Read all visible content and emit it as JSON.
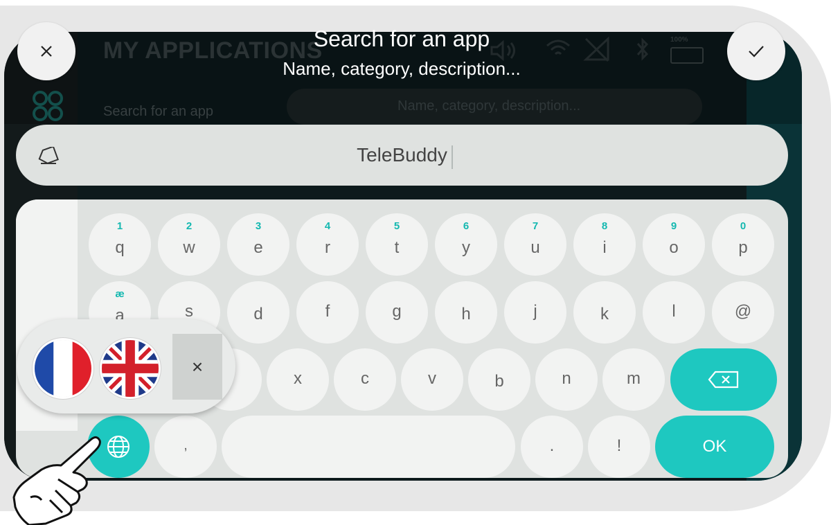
{
  "background": {
    "title": "MY APPLICATIONS",
    "search_label": "Search for an app",
    "search_placeholder": "Name, category, description...",
    "battery": "100%"
  },
  "header": {
    "title": "Search for an app",
    "subtitle": "Name, category, description..."
  },
  "search": {
    "value": "TeleBuddy"
  },
  "keyboard": {
    "row1": [
      {
        "key": "q",
        "alt": "1"
      },
      {
        "key": "w",
        "alt": "2"
      },
      {
        "key": "e",
        "alt": "3"
      },
      {
        "key": "r",
        "alt": "4"
      },
      {
        "key": "t",
        "alt": "5"
      },
      {
        "key": "y",
        "alt": "6"
      },
      {
        "key": "u",
        "alt": "7"
      },
      {
        "key": "i",
        "alt": "8"
      },
      {
        "key": "o",
        "alt": "9"
      },
      {
        "key": "p",
        "alt": "0"
      }
    ],
    "row2": [
      {
        "key": "a",
        "alt": "æ"
      },
      {
        "key": "s"
      },
      {
        "key": "d"
      },
      {
        "key": "f"
      },
      {
        "key": "g"
      },
      {
        "key": "h"
      },
      {
        "key": "j"
      },
      {
        "key": "k"
      },
      {
        "key": "l"
      },
      {
        "key": "@"
      }
    ],
    "row3": [
      "x",
      "c",
      "v",
      "b",
      "n",
      "m"
    ],
    "row3_partial": ".",
    "row4": {
      "comma": ",",
      "period": ".",
      "exclaim": "!"
    },
    "ok_label": "OK"
  },
  "language_popup": {
    "options": [
      "flag-france",
      "flag-united-kingdom"
    ],
    "close_label": "×"
  },
  "icons": {
    "close": "close-icon",
    "confirm": "check-icon",
    "eraser": "eraser-icon",
    "backspace": "backspace-icon",
    "globe": "globe-icon",
    "hand": "pointing-hand-icon"
  },
  "colors": {
    "accent": "#1ec8c0",
    "key_bg": "#f2f3f2",
    "keyboard_bg": "#dfe2e0",
    "screen_bg": "#0d1a1c"
  }
}
